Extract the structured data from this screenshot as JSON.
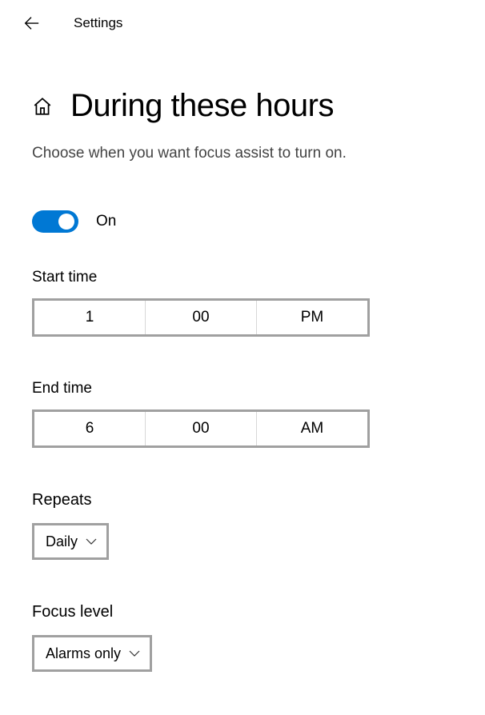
{
  "header": {
    "title": "Settings"
  },
  "page": {
    "title": "During these hours",
    "subtitle": "Choose when you want focus assist to turn on."
  },
  "toggle": {
    "state": "On",
    "enabled": true
  },
  "start_time": {
    "label": "Start time",
    "hour": "1",
    "minute": "00",
    "period": "PM"
  },
  "end_time": {
    "label": "End time",
    "hour": "6",
    "minute": "00",
    "period": "AM"
  },
  "repeats": {
    "label": "Repeats",
    "value": "Daily"
  },
  "focus_level": {
    "label": "Focus level",
    "value": "Alarms only"
  },
  "colors": {
    "accent": "#0078d4",
    "border": "#a0a0a0"
  }
}
